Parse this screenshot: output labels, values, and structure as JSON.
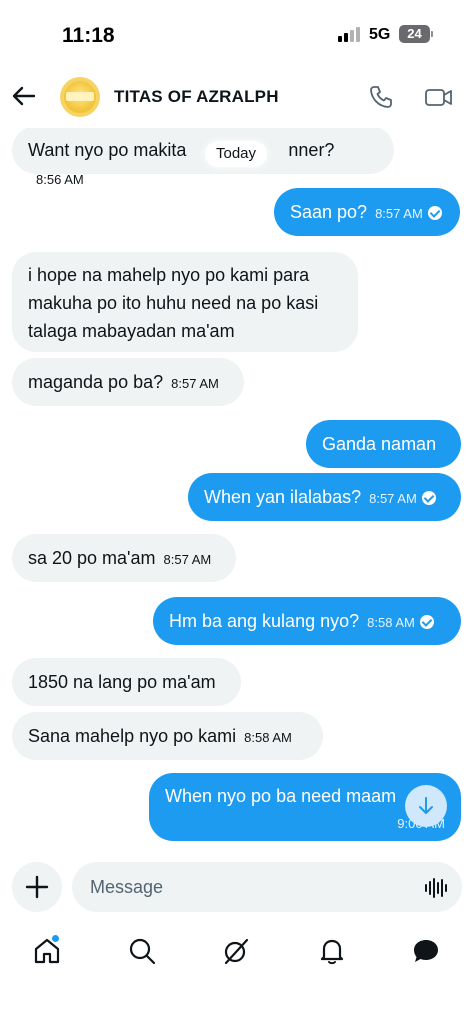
{
  "status_bar": {
    "time": "11:18",
    "network": "5G",
    "battery": "24"
  },
  "header": {
    "title": "TITAS OF AZRALPH",
    "avatar_label": "group-avatar"
  },
  "date_divider": "Today",
  "messages": [
    {
      "direction": "incoming",
      "text": "Want nyo po makita the dinner?",
      "text_visible_start": "Want nyo po makita",
      "text_visible_end": "nner?",
      "time": "8:56 AM"
    },
    {
      "direction": "outgoing",
      "text": "Saan po?",
      "time": "8:57 AM",
      "seen": true
    },
    {
      "direction": "incoming",
      "lines": [
        "i hope na mahelp nyo po kami para",
        "makuha po ito huhu need na po kasi",
        "talaga mabayadan ma'am"
      ]
    },
    {
      "direction": "incoming",
      "text": "maganda po ba?",
      "time": "8:57 AM"
    },
    {
      "direction": "outgoing",
      "text": "Ganda naman"
    },
    {
      "direction": "outgoing",
      "text": "When yan ilalabas?",
      "time": "8:57 AM",
      "seen": true
    },
    {
      "direction": "incoming",
      "text": "sa 20 po ma'am",
      "time": "8:57 AM"
    },
    {
      "direction": "outgoing",
      "text": "Hm ba ang kulang nyo?",
      "time": "8:58 AM",
      "seen": true
    },
    {
      "direction": "incoming",
      "text": "1850 na lang po ma'am"
    },
    {
      "direction": "incoming",
      "text": "Sana mahelp nyo po kami",
      "time": "8:58 AM"
    },
    {
      "direction": "outgoing",
      "text": "When nyo po ba need maam",
      "time": "9:00 AM"
    }
  ],
  "composer": {
    "placeholder": "Message"
  },
  "nav": {
    "items": [
      "home",
      "search",
      "grok",
      "notifications",
      "messages"
    ],
    "active": "messages",
    "home_has_badge": true
  },
  "colors": {
    "accent": "#1d9bf0",
    "incoming_bubble": "#eff3f4",
    "text": "#0f1419"
  }
}
